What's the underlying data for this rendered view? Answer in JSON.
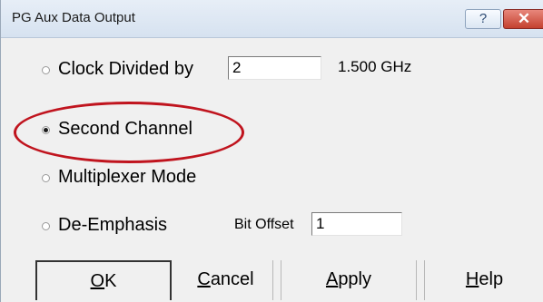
{
  "window": {
    "title": "PG Aux Data Output",
    "help_glyph": "?",
    "close_glyph": "✕"
  },
  "options": {
    "clock_divided": {
      "label": "Clock Divided by",
      "value": "2",
      "result": "1.500 GHz",
      "selected": false
    },
    "second_channel": {
      "label": "Second Channel",
      "selected": true
    },
    "multiplexer_mode": {
      "label": "Multiplexer Mode",
      "selected": false
    },
    "de_emphasis": {
      "label": "De-Emphasis",
      "selected": false,
      "bit_offset_label": "Bit Offset",
      "bit_offset_value": "1"
    }
  },
  "buttons": {
    "ok": {
      "mnemonic": "O",
      "rest": "K"
    },
    "cancel": {
      "mnemonic": "C",
      "rest": "ancel"
    },
    "apply": {
      "mnemonic": "A",
      "rest": "pply"
    },
    "help": {
      "mnemonic": "H",
      "rest": "elp"
    }
  },
  "colors": {
    "highlight": "#c0141e",
    "close_button": "#c4412f"
  }
}
